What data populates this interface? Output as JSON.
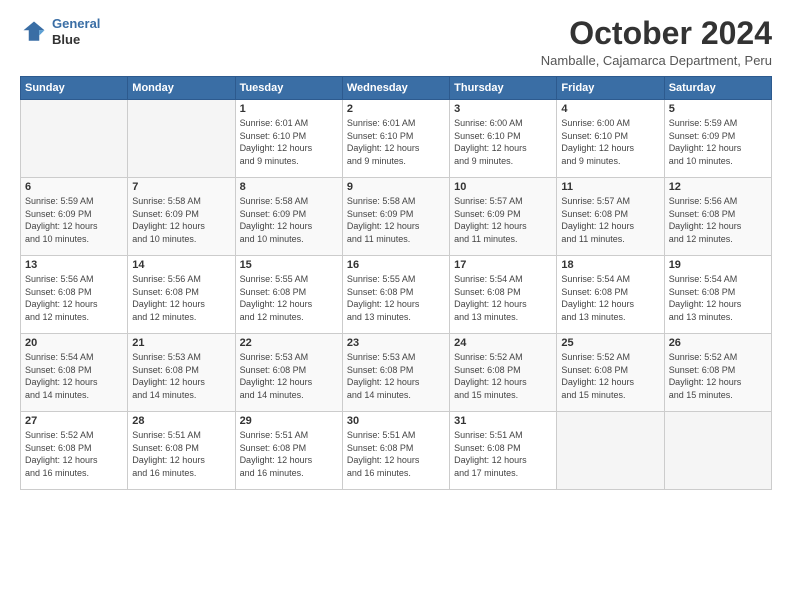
{
  "logo": {
    "line1": "General",
    "line2": "Blue"
  },
  "title": "October 2024",
  "subtitle": "Namballe, Cajamarca Department, Peru",
  "days_header": [
    "Sunday",
    "Monday",
    "Tuesday",
    "Wednesday",
    "Thursday",
    "Friday",
    "Saturday"
  ],
  "weeks": [
    [
      {
        "num": "",
        "info": ""
      },
      {
        "num": "",
        "info": ""
      },
      {
        "num": "1",
        "info": "Sunrise: 6:01 AM\nSunset: 6:10 PM\nDaylight: 12 hours\nand 9 minutes."
      },
      {
        "num": "2",
        "info": "Sunrise: 6:01 AM\nSunset: 6:10 PM\nDaylight: 12 hours\nand 9 minutes."
      },
      {
        "num": "3",
        "info": "Sunrise: 6:00 AM\nSunset: 6:10 PM\nDaylight: 12 hours\nand 9 minutes."
      },
      {
        "num": "4",
        "info": "Sunrise: 6:00 AM\nSunset: 6:10 PM\nDaylight: 12 hours\nand 9 minutes."
      },
      {
        "num": "5",
        "info": "Sunrise: 5:59 AM\nSunset: 6:09 PM\nDaylight: 12 hours\nand 10 minutes."
      }
    ],
    [
      {
        "num": "6",
        "info": "Sunrise: 5:59 AM\nSunset: 6:09 PM\nDaylight: 12 hours\nand 10 minutes."
      },
      {
        "num": "7",
        "info": "Sunrise: 5:58 AM\nSunset: 6:09 PM\nDaylight: 12 hours\nand 10 minutes."
      },
      {
        "num": "8",
        "info": "Sunrise: 5:58 AM\nSunset: 6:09 PM\nDaylight: 12 hours\nand 10 minutes."
      },
      {
        "num": "9",
        "info": "Sunrise: 5:58 AM\nSunset: 6:09 PM\nDaylight: 12 hours\nand 11 minutes."
      },
      {
        "num": "10",
        "info": "Sunrise: 5:57 AM\nSunset: 6:09 PM\nDaylight: 12 hours\nand 11 minutes."
      },
      {
        "num": "11",
        "info": "Sunrise: 5:57 AM\nSunset: 6:08 PM\nDaylight: 12 hours\nand 11 minutes."
      },
      {
        "num": "12",
        "info": "Sunrise: 5:56 AM\nSunset: 6:08 PM\nDaylight: 12 hours\nand 12 minutes."
      }
    ],
    [
      {
        "num": "13",
        "info": "Sunrise: 5:56 AM\nSunset: 6:08 PM\nDaylight: 12 hours\nand 12 minutes."
      },
      {
        "num": "14",
        "info": "Sunrise: 5:56 AM\nSunset: 6:08 PM\nDaylight: 12 hours\nand 12 minutes."
      },
      {
        "num": "15",
        "info": "Sunrise: 5:55 AM\nSunset: 6:08 PM\nDaylight: 12 hours\nand 12 minutes."
      },
      {
        "num": "16",
        "info": "Sunrise: 5:55 AM\nSunset: 6:08 PM\nDaylight: 12 hours\nand 13 minutes."
      },
      {
        "num": "17",
        "info": "Sunrise: 5:54 AM\nSunset: 6:08 PM\nDaylight: 12 hours\nand 13 minutes."
      },
      {
        "num": "18",
        "info": "Sunrise: 5:54 AM\nSunset: 6:08 PM\nDaylight: 12 hours\nand 13 minutes."
      },
      {
        "num": "19",
        "info": "Sunrise: 5:54 AM\nSunset: 6:08 PM\nDaylight: 12 hours\nand 13 minutes."
      }
    ],
    [
      {
        "num": "20",
        "info": "Sunrise: 5:54 AM\nSunset: 6:08 PM\nDaylight: 12 hours\nand 14 minutes."
      },
      {
        "num": "21",
        "info": "Sunrise: 5:53 AM\nSunset: 6:08 PM\nDaylight: 12 hours\nand 14 minutes."
      },
      {
        "num": "22",
        "info": "Sunrise: 5:53 AM\nSunset: 6:08 PM\nDaylight: 12 hours\nand 14 minutes."
      },
      {
        "num": "23",
        "info": "Sunrise: 5:53 AM\nSunset: 6:08 PM\nDaylight: 12 hours\nand 14 minutes."
      },
      {
        "num": "24",
        "info": "Sunrise: 5:52 AM\nSunset: 6:08 PM\nDaylight: 12 hours\nand 15 minutes."
      },
      {
        "num": "25",
        "info": "Sunrise: 5:52 AM\nSunset: 6:08 PM\nDaylight: 12 hours\nand 15 minutes."
      },
      {
        "num": "26",
        "info": "Sunrise: 5:52 AM\nSunset: 6:08 PM\nDaylight: 12 hours\nand 15 minutes."
      }
    ],
    [
      {
        "num": "27",
        "info": "Sunrise: 5:52 AM\nSunset: 6:08 PM\nDaylight: 12 hours\nand 16 minutes."
      },
      {
        "num": "28",
        "info": "Sunrise: 5:51 AM\nSunset: 6:08 PM\nDaylight: 12 hours\nand 16 minutes."
      },
      {
        "num": "29",
        "info": "Sunrise: 5:51 AM\nSunset: 6:08 PM\nDaylight: 12 hours\nand 16 minutes."
      },
      {
        "num": "30",
        "info": "Sunrise: 5:51 AM\nSunset: 6:08 PM\nDaylight: 12 hours\nand 16 minutes."
      },
      {
        "num": "31",
        "info": "Sunrise: 5:51 AM\nSunset: 6:08 PM\nDaylight: 12 hours\nand 17 minutes."
      },
      {
        "num": "",
        "info": ""
      },
      {
        "num": "",
        "info": ""
      }
    ]
  ]
}
